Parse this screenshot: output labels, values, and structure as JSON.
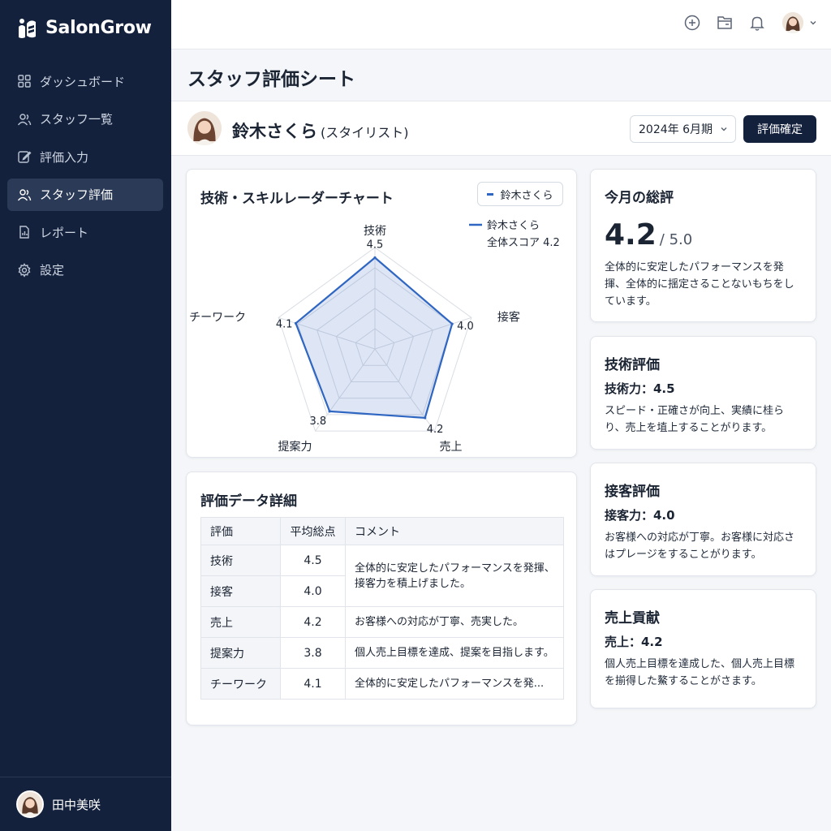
{
  "app": {
    "name": "SalonGrow"
  },
  "sidebar": {
    "items": [
      {
        "label": "ダッシュボード",
        "icon": "dashboard-icon"
      },
      {
        "label": "スタッフ一覧",
        "icon": "users-icon"
      },
      {
        "label": "評価入力",
        "icon": "edit-icon"
      },
      {
        "label": "スタッフ評価",
        "icon": "users-icon",
        "active": true
      },
      {
        "label": "レポート",
        "icon": "report-icon"
      },
      {
        "label": "設定",
        "icon": "gear-icon"
      }
    ],
    "footer_user": "田中美咲"
  },
  "page": {
    "title": "スタッフ評価シート"
  },
  "staff": {
    "name": "鈴木さくら",
    "role": "(スタイリスト)"
  },
  "period": {
    "selected": "2024年 6月期"
  },
  "confirm_label": "評価確定",
  "radar": {
    "title": "技術・スキルレーダーチャート",
    "legend_label": "鈴木さくら",
    "overlay_name": "鈴木さくら",
    "overlay_score": "全体スコア  4.2"
  },
  "chart_data": {
    "type": "radar",
    "title": "技術・スキルレーダーチャート",
    "axes": [
      "技術",
      "接客",
      "売上",
      "提案力",
      "チーワーク"
    ],
    "series": [
      {
        "name": "鈴木さくら",
        "values": [
          4.5,
          4.0,
          4.2,
          3.8,
          4.1
        ]
      }
    ],
    "value_labels": [
      "4.5",
      "4.0",
      "4.2",
      "3.8",
      "4.1"
    ],
    "range": [
      0,
      5
    ],
    "grid_levels": 5,
    "color": "#2f66c2"
  },
  "table": {
    "title": "評価データ詳細",
    "headers": [
      "評価",
      "平均総点",
      "コメント"
    ],
    "rows": [
      {
        "name": "技術",
        "score": "4.5"
      },
      {
        "name": "接客",
        "score": "4.0"
      },
      {
        "name": "売上",
        "score": "4.2"
      },
      {
        "name": "提案力",
        "score": "3.8"
      },
      {
        "name": "チーワーク",
        "score": "4.1"
      }
    ],
    "comments": [
      "全体的に安定したパフォーマンスを発揮、接客力を積上げました。",
      "お客様への対応が丁寧、売実した。",
      "個人売上目標を達成、提案を目指します。",
      "全体的に安定したパフォーマンスを発..."
    ]
  },
  "summary": {
    "title": "今月の総評",
    "score": "4.2",
    "max": "/ 5.0",
    "text": "全体的に安定したパフォーマンスを発揮、全体的に揺定さることないもちをしています。"
  },
  "tech": {
    "title": "技術評価",
    "sub": "技術力：4.5",
    "text": "スピード・正確さが向上、実績に桂らり、売上を埴上することがります。"
  },
  "service": {
    "title": "接客評価",
    "sub": "接客力：4.0",
    "text": "お客様への対応が丁寧。お客様に対応さはプレージをすることがります。"
  },
  "sales": {
    "title": "売上貢献",
    "sub": "売上：4.2",
    "text": "個人売上目標を達成した、個人売上目標を揃得した鰲することがさます。"
  },
  "colors": {
    "sidebar_bg": "#14213d",
    "accent": "#2f66c2",
    "button_bg": "#14213d"
  }
}
